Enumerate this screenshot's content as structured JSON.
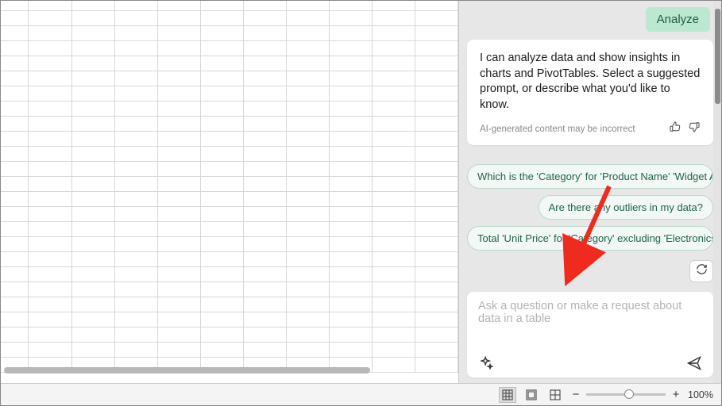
{
  "sidebar": {
    "analyze_label": "Analyze",
    "intro": "I can analyze data and show insights in charts and PivotTables. Select a suggested prompt, or describe what you'd like to know.",
    "disclaimer": "AI-generated content may be incorrect",
    "suggestions": [
      "Which is the 'Category' for 'Product Name' 'Widget A'",
      "Are there any outliers in my data?",
      "Total 'Unit Price' for 'Category' excluding 'Electronics'"
    ],
    "prompt_placeholder": "Ask a question or make a request about data in a table"
  },
  "statusbar": {
    "zoom_label": "100%"
  }
}
